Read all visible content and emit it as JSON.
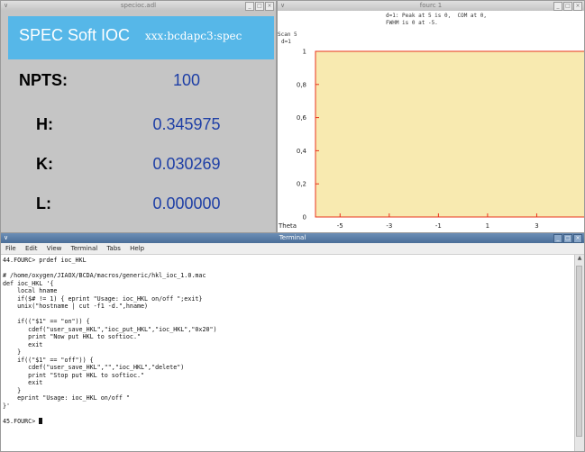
{
  "ioc_window": {
    "title": "specioc.adl",
    "header_title": "SPEC Soft IOC",
    "header_pv": "xxx:bcdapc3:spec",
    "rows": [
      {
        "label": "NPTS:",
        "value": "100"
      },
      {
        "label": "H:",
        "value": "0.345975"
      },
      {
        "label": "K:",
        "value": "0.030269"
      },
      {
        "label": "L:",
        "value": "0.000000"
      }
    ]
  },
  "plot_window": {
    "title": "fourc 1",
    "info_line1": "d=1: Peak at 5 is 0,  COM at 0,",
    "info_line2": "FWHM is 0 at -5.",
    "ylabel_line1": "Scan 5",
    "ylabel_line2": "d=1",
    "xlabel": "Theta",
    "colors": {
      "plot_bg": "#f8eab0",
      "frame": "#e8341c"
    }
  },
  "chart_data": {
    "type": "line",
    "title": "",
    "xlabel": "Theta",
    "ylabel": "Scan 5",
    "xlim": [
      -6,
      5
    ],
    "ylim": [
      0,
      1
    ],
    "xticks": [
      "-5",
      "-3",
      "-1",
      "1",
      "3"
    ],
    "yticks": [
      "0",
      "0,2",
      "0,4",
      "0,6",
      "0,8",
      "1"
    ],
    "series": []
  },
  "terminal": {
    "title": "Terminal",
    "menu": [
      "File",
      "Edit",
      "View",
      "Terminal",
      "Tabs",
      "Help"
    ],
    "lines": [
      "44.FOURC> prdef ioc_HKL",
      "",
      "# /home/oxygen/JIAOX/BCDA/macros/generic/hkl_ioc_1.0.mac",
      "def ioc_HKL '{",
      "    local hname",
      "    if($# != 1) { eprint \"Usage: ioc_HKL on/off \";exit}",
      "    unix(\"hostname | cut -f1 -d.\",hname)",
      "",
      "    if((\"$1\" == \"on\")) {",
      "       cdef(\"user_save_HKL\",\"ioc_put_HKL\",\"ioc_HKL\",\"0x20\")",
      "       print \"Now put HKL to softioc.\"",
      "       exit",
      "    }",
      "    if((\"$1\" == \"off\")) {",
      "       cdef(\"user_save_HKL\",\"\",\"ioc_HKL\",\"delete\")",
      "       print \"Stop put HKL to softioc.\"",
      "       exit",
      "    }",
      "    eprint \"Usage: ioc_HKL on/off \"",
      "}'",
      "",
      "45.FOURC> "
    ]
  }
}
